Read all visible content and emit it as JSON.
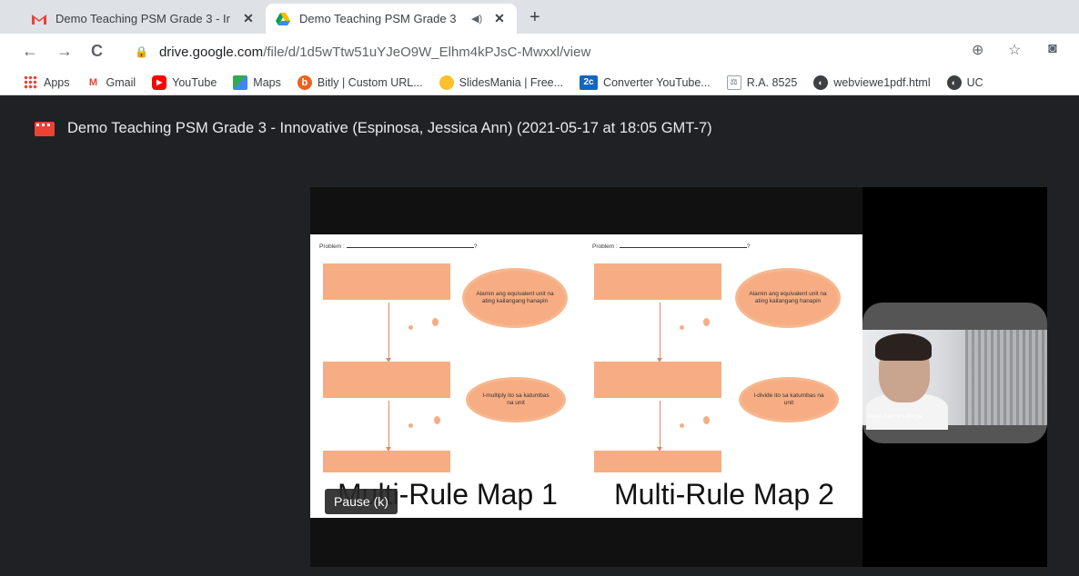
{
  "tabs": [
    {
      "title": "Demo Teaching PSM Grade 3 - Ir",
      "close": "✕",
      "favicon": "gmail-icon"
    },
    {
      "title": "Demo Teaching PSM Grade 3",
      "close": "✕",
      "favicon": "drive-icon",
      "audio": "speaker-icon"
    }
  ],
  "newtab": "+",
  "nav": {
    "back": "←",
    "forward": "→",
    "reload": "C"
  },
  "url": {
    "host": "drive.google.com",
    "path": "/file/d/1d5wTtw51uYJeO9W_Elhm4kPJsC-Mwxxl/view"
  },
  "bookmarks": [
    {
      "label": "Apps",
      "icon": "apps-grid-icon"
    },
    {
      "label": "Gmail",
      "icon": "gmail-icon"
    },
    {
      "label": "YouTube",
      "icon": "youtube-icon"
    },
    {
      "label": "Maps",
      "icon": "maps-icon"
    },
    {
      "label": "Bitly | Custom URL...",
      "icon": "bitly-icon"
    },
    {
      "label": "SlidesMania | Free...",
      "icon": "slidesmania-icon"
    },
    {
      "label": "Converter YouTube...",
      "icon": "converter-icon"
    },
    {
      "label": "R.A. 8525",
      "icon": "law-icon"
    },
    {
      "label": "webviewe1pdf.html",
      "icon": "globe-icon"
    },
    {
      "label": "UC",
      "icon": "globe-icon"
    }
  ],
  "viewer": {
    "title": "Demo Teaching PSM Grade 3 - Innovative (Espinosa, Jessica Ann) (2021-05-17 at 18:05 GMT-7)"
  },
  "slide": {
    "problem_label": "Problem :",
    "problem_mark": "?",
    "map1": {
      "cloud1": "Alamin ang equivalent unit na ating kailangang hanapin",
      "cloud2": "I-multiply ito sa katumbas na unit",
      "label": "Multi-Rule Map 1"
    },
    "map2": {
      "cloud1": "Alamin ang equivalent unit na ating kailangang hanapin",
      "cloud2": "I-divide ito sa katumbas na unit",
      "label": "Multi-Rule Map 2"
    }
  },
  "tooltip": "Pause (k)",
  "camera": {
    "participant": "Allein Lance Laforga"
  },
  "colors": {
    "box": "#f7ad83",
    "tab_bg": "#dee1e6",
    "viewer_bg": "#202124"
  }
}
